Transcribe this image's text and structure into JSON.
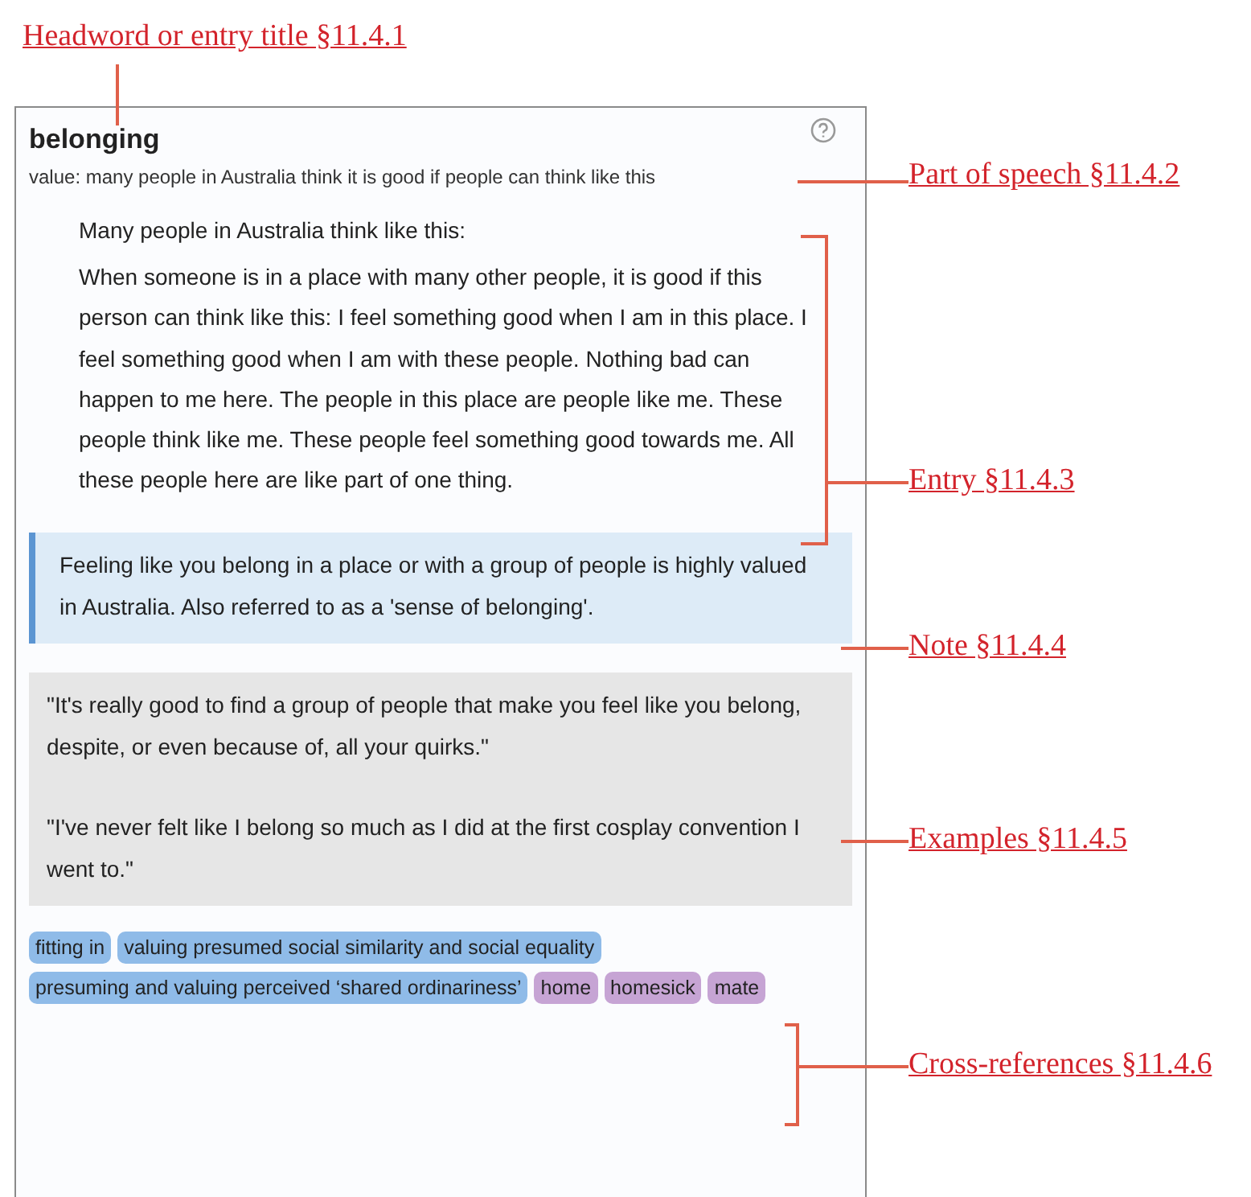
{
  "entry": {
    "headword": "belonging",
    "part_of_speech": "value: many people in Australia think it is good if people can think like this",
    "definition": [
      "Many people in Australia think like this:",
      "When someone is in a place with many other people, it is good if this person can think like this: I feel something good when I am in this place. I feel something good when I am with these people. Nothing bad can happen to me here. The people in this place are people like me. These people think like me. These people feel something good towards me. All these people here are like part of one thing."
    ],
    "note": "Feeling like you belong in a place or with a group of people is highly valued in Australia. Also referred to as a 'sense of belonging'.",
    "examples": [
      "\"It's really good to find a group of people that make you feel like you belong, despite, or even because of, all your quirks.\"",
      "\"I've never felt like I belong so much as I did at the first cosplay convention I went to.\""
    ],
    "cross_references": [
      {
        "label": "fitting in",
        "color": "#8fbbe8"
      },
      {
        "label": "valuing presumed social similarity and social equality",
        "color": "#8fbbe8"
      },
      {
        "label": "presuming and valuing perceived ‘shared ordinariness’",
        "color": "#8fbbe8"
      },
      {
        "label": "home",
        "color": "#c6a4d4"
      },
      {
        "label": "homesick",
        "color": "#c6a4d4"
      },
      {
        "label": "mate",
        "color": "#c6a4d4"
      }
    ]
  },
  "callouts": [
    "Headword or entry title §11.4.1",
    "Part of speech §11.4.2",
    "Entry §11.4.3",
    "Note §11.4.4",
    "Examples §11.4.5",
    "Cross-references §11.4.6"
  ]
}
